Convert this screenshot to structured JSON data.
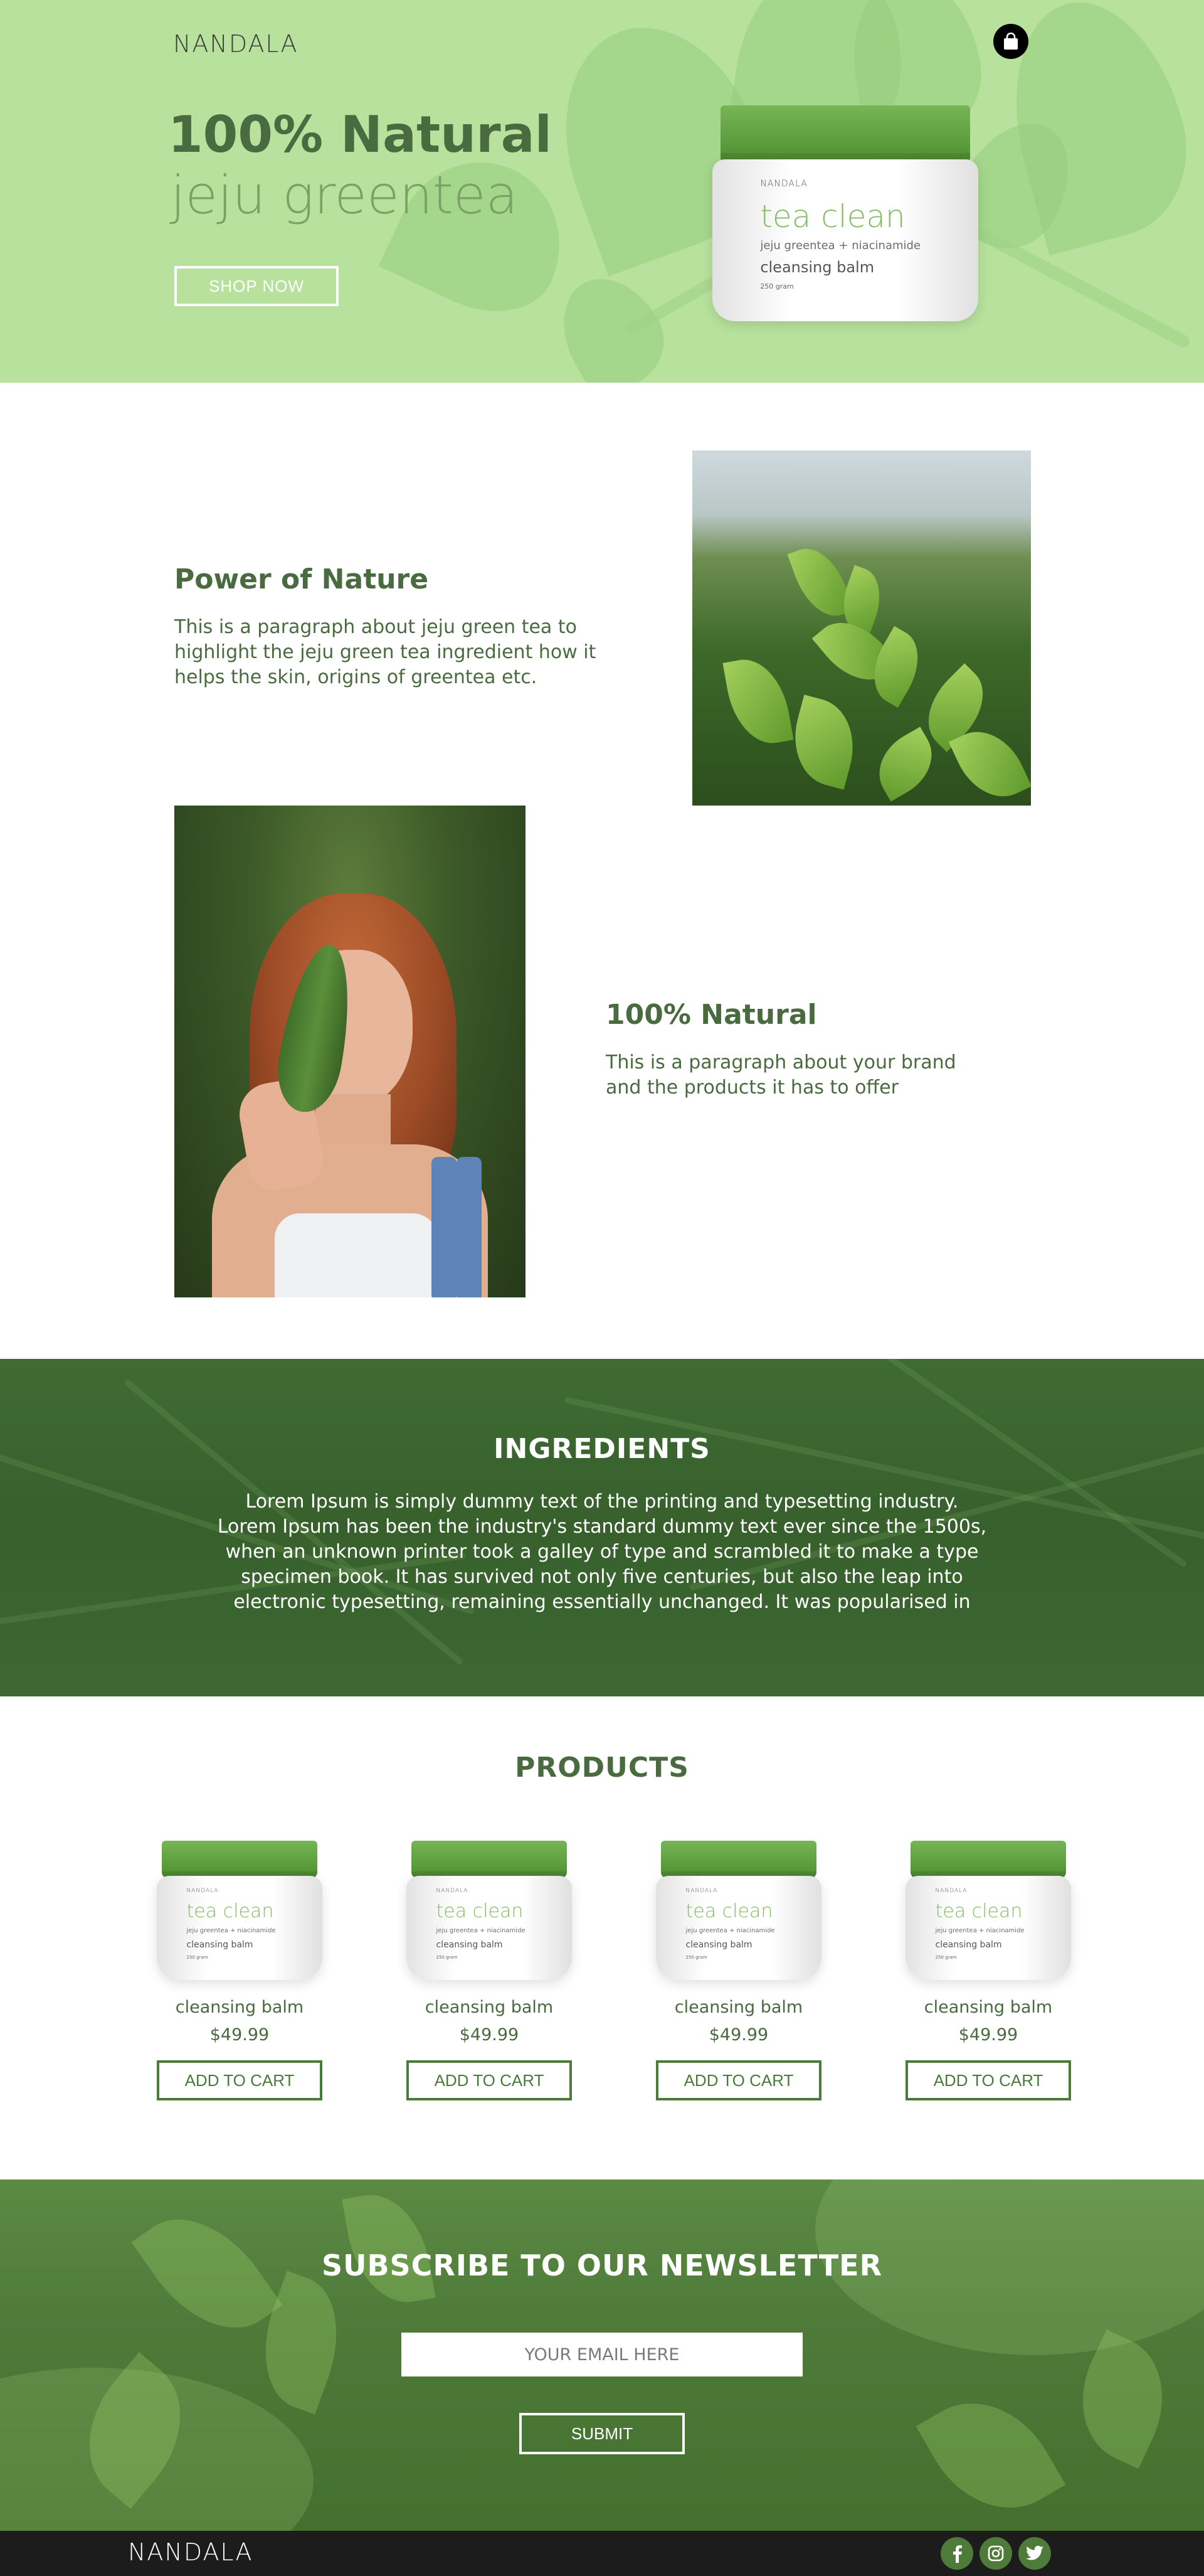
{
  "brand": "NANDALA",
  "hero": {
    "title": "100% Natural",
    "subtitle": "jeju greentea",
    "cta": "SHOP NOW"
  },
  "jar_label": {
    "brand": "NANDALA",
    "name": "tea clean",
    "ingredients": "jeju greentea + niacinamide",
    "type": "cleansing balm",
    "weight": "250 gram"
  },
  "features": [
    {
      "title": "Power of Nature",
      "text": "This is a paragraph about jeju green tea to highlight the jeju green tea ingredient how it helps the skin, origins of greentea etc."
    },
    {
      "title": "100% Natural",
      "text": "This is a paragraph about your brand and the products it has to offer"
    }
  ],
  "ingredients": {
    "heading": "INGREDIENTS",
    "text": "Lorem Ipsum is simply dummy text of the printing and typesetting industry. Lorem Ipsum has been the industry's standard dummy text ever since the 1500s, when an unknown printer took a galley of type and scrambled it to make a type specimen book. It has survived not only five centuries, but also the leap into electronic typesetting, remaining essentially unchanged. It was popularised in"
  },
  "products": {
    "heading": "PRODUCTS",
    "add_label": "ADD TO CART",
    "items": [
      {
        "name": "cleansing balm",
        "price": "$49.99"
      },
      {
        "name": "cleansing balm",
        "price": "$49.99"
      },
      {
        "name": "cleansing balm",
        "price": "$49.99"
      },
      {
        "name": "cleansing balm",
        "price": "$49.99"
      }
    ]
  },
  "newsletter": {
    "heading": "SUBSCRIBE TO OUR NEWSLETTER",
    "placeholder": "YOUR EMAIL HERE",
    "submit": "SUBMIT"
  },
  "icons": {
    "cart": "shopping-bag-icon",
    "social": [
      "facebook-icon",
      "instagram-icon",
      "twitter-icon"
    ]
  },
  "colors": {
    "hero_bg": "#b7e19c",
    "primary_green": "#4a6b3f",
    "ingredients_bg": "#3a632e",
    "footer_bg": "#1c1c1c"
  }
}
